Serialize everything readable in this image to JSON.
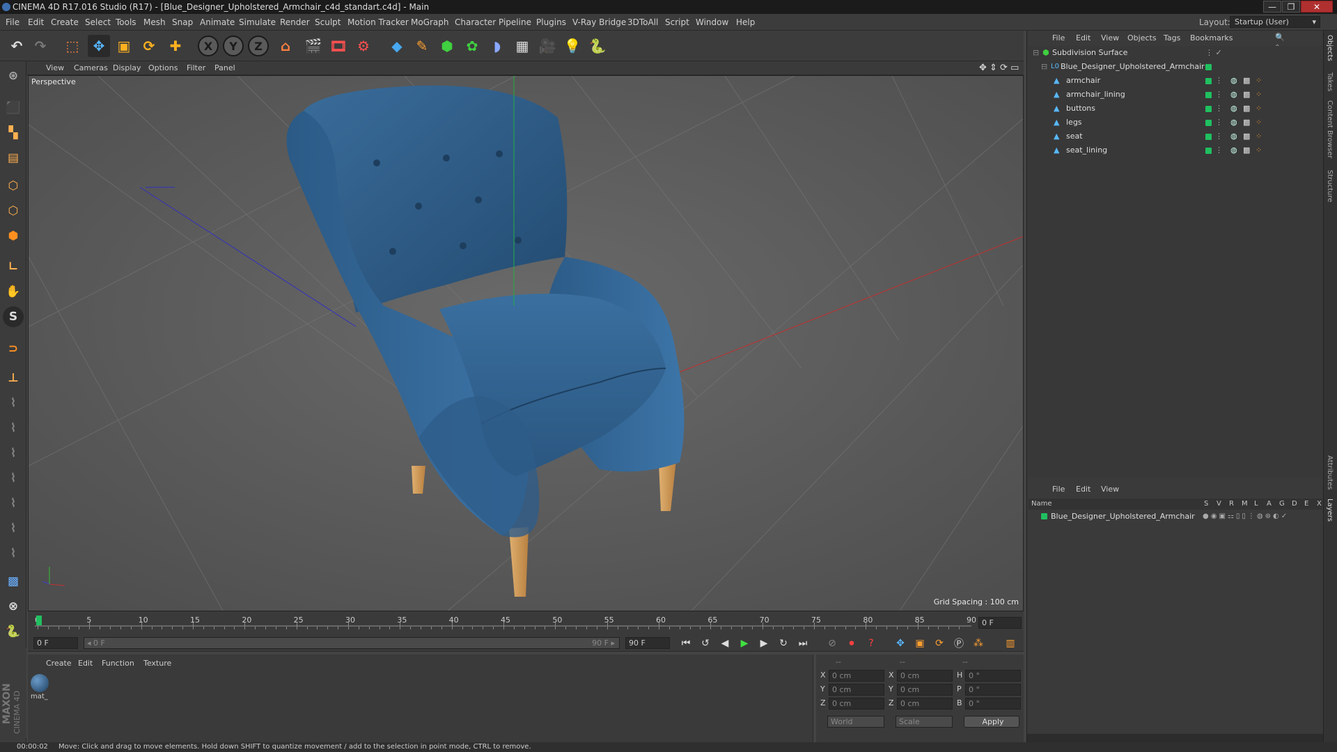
{
  "window": {
    "title": "CINEMA 4D R17.016 Studio (R17) - [Blue_Designer_Upholstered_Armchair_c4d_standart.c4d] - Main",
    "minimize": "—",
    "maximize": "❐",
    "close": "✕"
  },
  "menubar": {
    "items": [
      "File",
      "Edit",
      "Create",
      "Select",
      "Tools",
      "Mesh",
      "Snap",
      "Animate",
      "Simulate",
      "Render",
      "Sculpt",
      "Motion Tracker",
      "MoGraph",
      "Character",
      "Pipeline",
      "Plugins",
      "V-Ray Bridge",
      "3DToAll",
      "Script",
      "Window",
      "Help"
    ],
    "layout_label": "Layout:",
    "layout_value": "Startup (User)"
  },
  "viewport": {
    "menu": [
      "View",
      "Cameras",
      "Display",
      "Options",
      "Filter",
      "Panel"
    ],
    "label": "Perspective",
    "grid_spacing": "Grid Spacing : 100 cm"
  },
  "timeline": {
    "ticks": [
      "0",
      "5",
      "10",
      "15",
      "20",
      "25",
      "30",
      "35",
      "40",
      "45",
      "50",
      "55",
      "60",
      "65",
      "70",
      "75",
      "80",
      "85",
      "90"
    ],
    "frame_end_field": "0 F"
  },
  "transport": {
    "start_field": "0 F",
    "range_start": "◂ 0 F",
    "range_end": "90 F ▸",
    "end_field": "90 F"
  },
  "material_panel": {
    "menu": [
      "Create",
      "Edit",
      "Function",
      "Texture"
    ],
    "materials": [
      {
        "name": "mat_"
      }
    ]
  },
  "coordinates": {
    "headers": [
      "--",
      "--",
      "--"
    ],
    "rows": [
      {
        "a": "X",
        "av": "0 cm",
        "b": "X",
        "bv": "0 cm",
        "c": "H",
        "cv": "0 °"
      },
      {
        "a": "Y",
        "av": "0 cm",
        "b": "Y",
        "bv": "0 cm",
        "c": "P",
        "cv": "0 °"
      },
      {
        "a": "Z",
        "av": "0 cm",
        "b": "Z",
        "bv": "0 cm",
        "c": "B",
        "cv": "0 °"
      }
    ],
    "world": "World",
    "scale": "Scale",
    "apply": "Apply"
  },
  "object_manager": {
    "menu": [
      "File",
      "Edit",
      "View",
      "Objects",
      "Tags",
      "Bookmarks"
    ],
    "root": "Subdivision Surface",
    "group": "Blue_Designer_Upholstered_Armchair",
    "children": [
      "armchair",
      "armchair_lining",
      "buttons",
      "legs",
      "seat",
      "seat_lining"
    ]
  },
  "layer_manager": {
    "menu": [
      "File",
      "Edit",
      "View"
    ],
    "name_header": "Name",
    "columns": [
      "S",
      "V",
      "R",
      "M",
      "L",
      "A",
      "G",
      "D",
      "E",
      "X"
    ],
    "rows": [
      "Blue_Designer_Upholstered_Armchair"
    ]
  },
  "right_tabs": [
    "Objects",
    "Takes",
    "Content Browser",
    "Structure"
  ],
  "right_tabs_lower": [
    "Attributes",
    "Layers"
  ],
  "statusbar": {
    "time": "00:00:02",
    "message": "Move: Click and drag to move elements. Hold down SHIFT to quantize movement / add to the selection in point mode, CTRL to remove."
  },
  "branding": {
    "line1": "MAXON",
    "line2": "CINEMA 4D"
  },
  "colors": {
    "accent": "#2f8fd8",
    "layer_green": "#20c060",
    "chair_blue": "#2f5f8c",
    "leg_wood": "#d8a060"
  }
}
